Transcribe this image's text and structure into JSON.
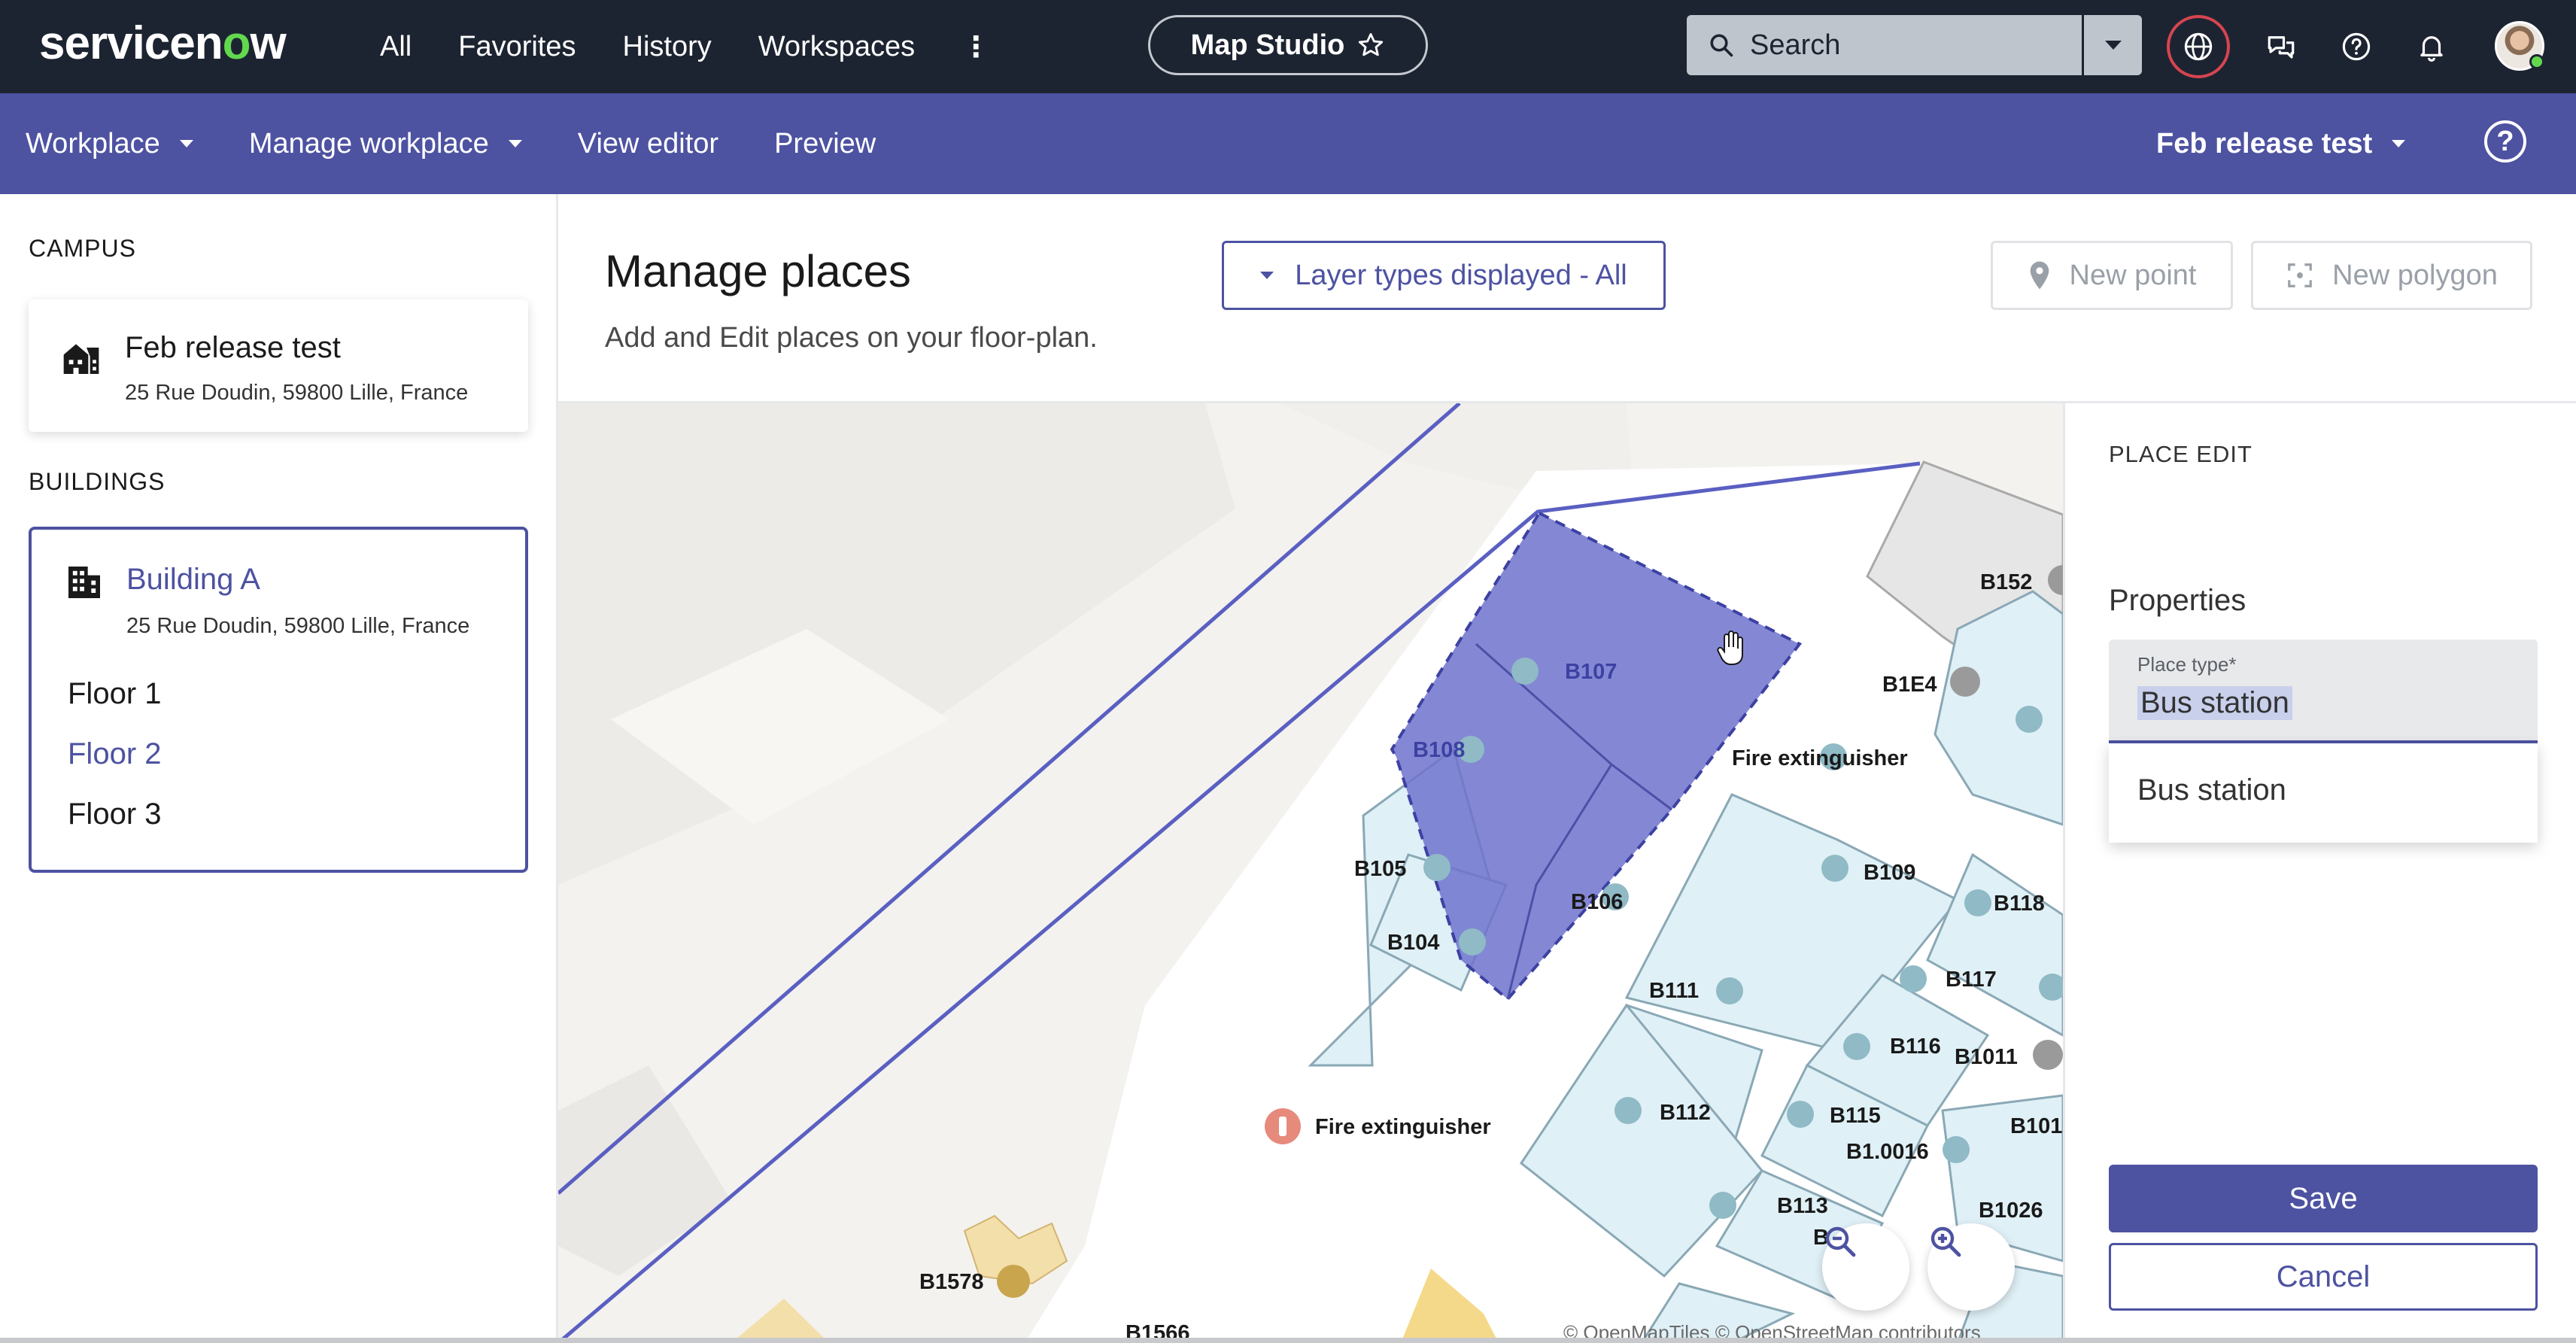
{
  "topbar": {
    "logo": "servicenow",
    "nav": [
      "All",
      "Favorites",
      "History",
      "Workspaces"
    ],
    "studio": "Map Studio",
    "search_placeholder": "Search"
  },
  "subbar": {
    "items": [
      "Workplace",
      "Manage workplace",
      "View editor",
      "Preview"
    ],
    "release": "Feb release test"
  },
  "sidebar": {
    "campus_label": "CAMPUS",
    "campus": {
      "name": "Feb release test",
      "address": "25 Rue Doudin, 59800 Lille, France"
    },
    "buildings_label": "BUILDINGS",
    "building": {
      "name": "Building A",
      "address": "25 Rue Doudin, 59800 Lille, France"
    },
    "floors": [
      "Floor 1",
      "Floor 2",
      "Floor 3"
    ],
    "active_floor": "Floor 2"
  },
  "header": {
    "title": "Manage places",
    "subtitle": "Add and Edit places on your floor-plan.",
    "layer_button": "Layer types displayed - All",
    "new_point": "New point",
    "new_polygon": "New polygon"
  },
  "map": {
    "labels": [
      "B152",
      "B1E4",
      "B107",
      "B108",
      "Fire extinguisher",
      "B105",
      "B106",
      "B109",
      "B118",
      "B104",
      "B117",
      "B111",
      "B116",
      "B1011",
      "B112",
      "B115",
      "B101",
      "B1.0016",
      "B113",
      "B1026",
      "B1578",
      "B1566",
      "B"
    ],
    "attribution": "© OpenMapTiles © OpenStreetMap contributors"
  },
  "place_edit": {
    "section": "PLACE EDIT",
    "properties": "Properties",
    "place_type_label": "Place type*",
    "place_type_value": "Bus station",
    "dropdown_options": [
      "Bus station"
    ],
    "save": "Save",
    "cancel": "Cancel"
  },
  "colors": {
    "topbar": "#1d2431",
    "accent": "#4d52a1",
    "room_fill": "#dff0f6",
    "selected_fill": "#6f73cc"
  }
}
